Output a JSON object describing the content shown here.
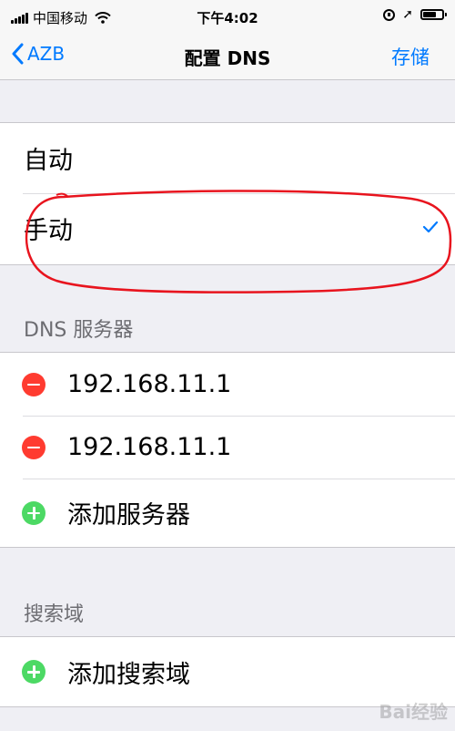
{
  "status_bar": {
    "carrier": "中国移动",
    "time": "下午4:02"
  },
  "nav": {
    "back_label": "AZB",
    "title": "配置 DNS",
    "save_label": "存储"
  },
  "mode_options": [
    {
      "label": "自动",
      "selected": false
    },
    {
      "label": "手动",
      "selected": true
    }
  ],
  "dns_section": {
    "header": "DNS 服务器",
    "servers": [
      "192.168.11.1",
      "192.168.11.1"
    ],
    "add_label": "添加服务器"
  },
  "search_section": {
    "header": "搜索域",
    "add_label": "添加搜索域"
  },
  "colors": {
    "accent": "#007aff",
    "delete": "#ff3b30",
    "add": "#4cd964",
    "annotation": "#e8141e"
  },
  "watermark": "Bai经验"
}
